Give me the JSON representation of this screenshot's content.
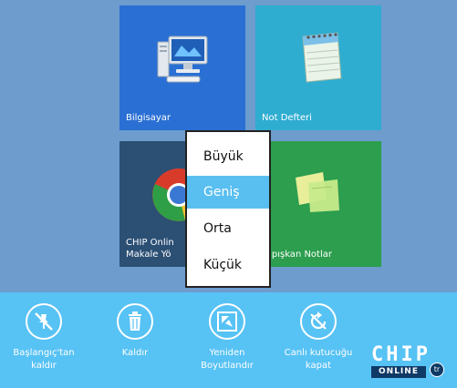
{
  "tiles": {
    "computer": {
      "label": "Bilgisayar",
      "icon": "computer-icon"
    },
    "notepad": {
      "label": "Not Defteri",
      "icon": "notepad-icon"
    },
    "chrome": {
      "label_line1": "CHIP Onlin",
      "label_line2": "Makale Yö",
      "icon": "chrome-icon"
    },
    "sticky": {
      "label": "Yapışkan Notlar",
      "icon": "sticky-notes-icon"
    }
  },
  "resize_menu": {
    "items": [
      "Büyük",
      "Geniş",
      "Orta",
      "Küçük"
    ],
    "selected": "Geniş"
  },
  "appbar": {
    "commands": [
      {
        "label_line1": "Başlangıç'tan",
        "label_line2": "kaldır",
        "icon": "unpin-icon"
      },
      {
        "label_line1": "Kaldır",
        "label_line2": "",
        "icon": "trash-icon"
      },
      {
        "label_line1": "Yeniden",
        "label_line2": "Boyutlandır",
        "icon": "resize-icon"
      },
      {
        "label_line1": "Canlı kutucuğu",
        "label_line2": "kapat",
        "icon": "live-tile-off-icon"
      }
    ]
  },
  "logo": {
    "text_main": "CHIP",
    "text_sub": "ONLINE",
    "badge": "tr"
  },
  "colors": {
    "background": "#6d9ccd",
    "appbar": "#57c2f4",
    "menu_selected": "#59bff0",
    "tile_computer": "#2a6fd4",
    "tile_notepad": "#2eadd1",
    "tile_chrome": "#2c4f74",
    "tile_sticky": "#2c9e4e"
  }
}
